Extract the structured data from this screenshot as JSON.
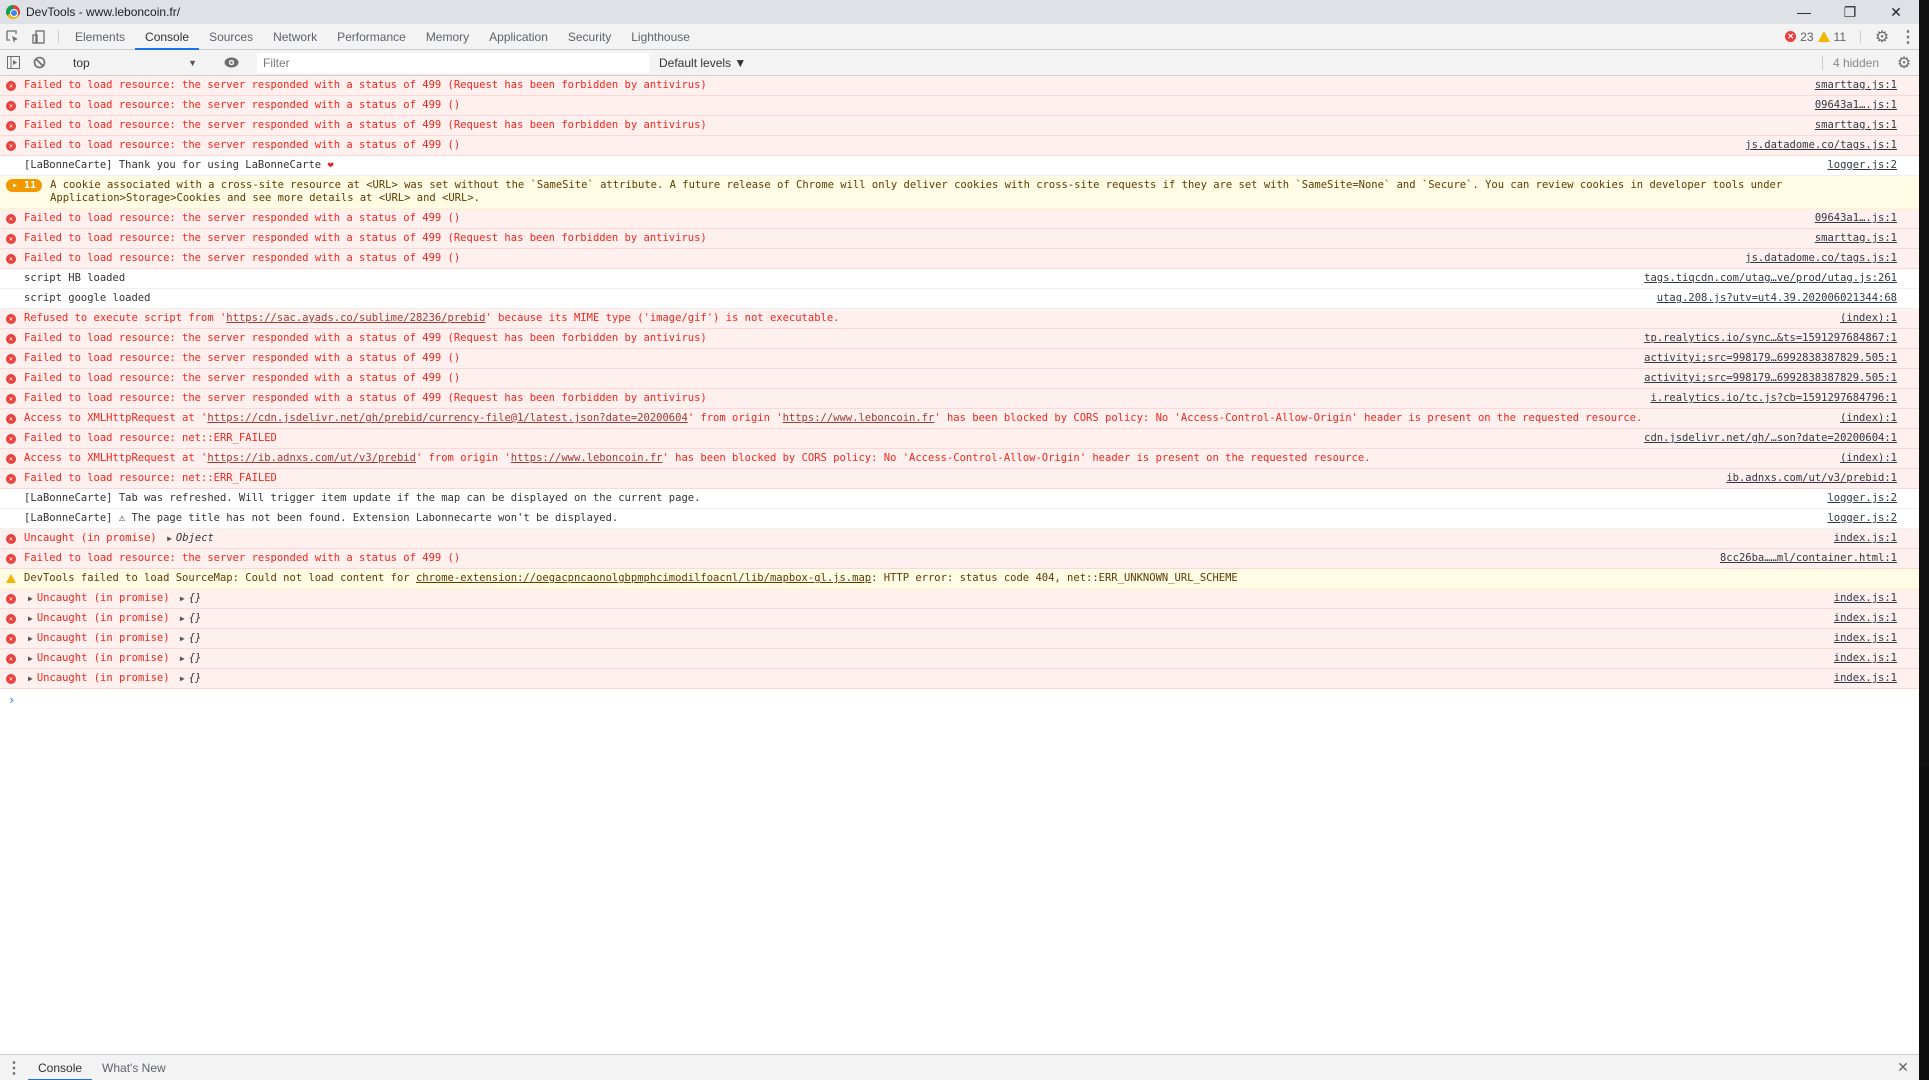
{
  "window": {
    "title": "DevTools - www.leboncoin.fr/",
    "controls": {
      "minimize": "—",
      "restore": "❐",
      "close": "✕"
    }
  },
  "tabs": [
    {
      "label": "Elements",
      "active": false
    },
    {
      "label": "Console",
      "active": true
    },
    {
      "label": "Sources",
      "active": false
    },
    {
      "label": "Network",
      "active": false
    },
    {
      "label": "Performance",
      "active": false
    },
    {
      "label": "Memory",
      "active": false
    },
    {
      "label": "Application",
      "active": false
    },
    {
      "label": "Security",
      "active": false
    },
    {
      "label": "Lighthouse",
      "active": false
    }
  ],
  "counts": {
    "errors": "23",
    "warnings": "11"
  },
  "console_toolbar": {
    "context": "top",
    "filter_placeholder": "Filter",
    "filter_value": "",
    "levels": "Default levels ▼",
    "hidden": "4 hidden"
  },
  "messages": [
    {
      "level": "error",
      "text": "Failed to load resource: the server responded with a status of 499 (Request has been forbidden by antivirus)",
      "source": "smarttag.js:1"
    },
    {
      "level": "error",
      "text": "Failed to load resource: the server responded with a status of 499 ()",
      "source": "09643a1….js:1"
    },
    {
      "level": "error",
      "text": "Failed to load resource: the server responded with a status of 499 (Request has been forbidden by antivirus)",
      "source": "smarttag.js:1"
    },
    {
      "level": "error",
      "text": "Failed to load resource: the server responded with a status of 499 ()",
      "source": "js.datadome.co/tags.js:1"
    },
    {
      "level": "info",
      "text": "[LaBonneCarte] Thank you for using LaBonneCarte",
      "suffix": "❤",
      "source": "logger.js:2"
    },
    {
      "level": "warning",
      "repeat": "11",
      "text": "A cookie associated with a cross-site resource at <URL> was set without the `SameSite` attribute. A future release of Chrome will only deliver cookies with cross-site requests if they are set with `SameSite=None` and `Secure`. You can review cookies in developer tools under Application>Storage>Cookies and see more details at <URL> and <URL>.",
      "source": ""
    },
    {
      "level": "error",
      "text": "Failed to load resource: the server responded with a status of 499 ()",
      "source": "09643a1….js:1"
    },
    {
      "level": "error",
      "text": "Failed to load resource: the server responded with a status of 499 (Request has been forbidden by antivirus)",
      "source": "smarttag.js:1"
    },
    {
      "level": "error",
      "text": "Failed to load resource: the server responded with a status of 499 ()",
      "source": "js.datadome.co/tags.js:1"
    },
    {
      "level": "info",
      "text": "script HB loaded",
      "source": "tags.tiqcdn.com/utag…ve/prod/utag.js:261"
    },
    {
      "level": "info",
      "text": "script google loaded",
      "source": "utag.208.js?utv=ut4.39.202006021344:68"
    },
    {
      "level": "error",
      "parts": [
        "Refused to execute script from '",
        {
          "link": "https://sac.ayads.co/sublime/28236/prebid"
        },
        "' because its MIME type ('image/gif') is not executable."
      ],
      "source": "(index):1"
    },
    {
      "level": "error",
      "text": "Failed to load resource: the server responded with a status of 499 (Request has been forbidden by antivirus)",
      "source": "tp.realytics.io/sync…&ts=1591297684867:1"
    },
    {
      "level": "error",
      "text": "Failed to load resource: the server responded with a status of 499 ()",
      "source": "activityi;src=998179…6992838387829.505:1"
    },
    {
      "level": "error",
      "text": "Failed to load resource: the server responded with a status of 499 ()",
      "source": "activityi;src=998179…6992838387829.505:1"
    },
    {
      "level": "error",
      "text": "Failed to load resource: the server responded with a status of 499 (Request has been forbidden by antivirus)",
      "source": "i.realytics.io/tc.js?cb=1591297684796:1"
    },
    {
      "level": "error",
      "parts": [
        "Access to XMLHttpRequest at '",
        {
          "link": "https://cdn.jsdelivr.net/gh/prebid/currency-file@1/latest.json?date=20200604"
        },
        "' from origin '",
        {
          "link": "https://www.leboncoin.fr"
        },
        "' has been blocked by CORS policy: No 'Access-Control-Allow-Origin' header is present on the requested resource."
      ],
      "source": "(index):1"
    },
    {
      "level": "error",
      "text": "Failed to load resource: net::ERR_FAILED",
      "source": "cdn.jsdelivr.net/gh/…son?date=20200604:1"
    },
    {
      "level": "error",
      "parts": [
        "Access to XMLHttpRequest at '",
        {
          "link": "https://ib.adnxs.com/ut/v3/prebid"
        },
        "' from origin '",
        {
          "link": "https://www.leboncoin.fr"
        },
        "' has been blocked by CORS policy: No 'Access-Control-Allow-Origin' header is present on the requested resource."
      ],
      "source": "(index):1"
    },
    {
      "level": "error",
      "text": "Failed to load resource: net::ERR_FAILED",
      "source": "ib.adnxs.com/ut/v3/prebid:1"
    },
    {
      "level": "info",
      "text": "[LaBonneCarte] Tab was refreshed. Will trigger item update if the map can be displayed on the current page.",
      "source": "logger.js:2"
    },
    {
      "level": "info",
      "text": "[LaBonneCarte] ⚠ The page title has not been found. Extension Labonnecarte won't be displayed.",
      "source": "logger.js:2"
    },
    {
      "level": "error",
      "text": "Uncaught (in promise) ",
      "expand": "Object",
      "source": "index.js:1"
    },
    {
      "level": "error",
      "text": "Failed to load resource: the server responded with a status of 499 ()",
      "source": "8cc26ba……ml/container.html:1"
    },
    {
      "level": "warning",
      "parts": [
        "DevTools failed to load SourceMap: Could not load content for ",
        {
          "link": "chrome-extension://oegacpncaonolgbpmphcimodilfoacnl/lib/mapbox-gl.js.map"
        },
        ": HTTP error: status code 404, net::ERR_UNKNOWN_URL_SCHEME"
      ],
      "source": ""
    },
    {
      "level": "error",
      "collapsible": true,
      "text": "Uncaught (in promise) ",
      "expand": "{}",
      "source": "index.js:1"
    },
    {
      "level": "error",
      "collapsible": true,
      "text": "Uncaught (in promise) ",
      "expand": "{}",
      "source": "index.js:1"
    },
    {
      "level": "error",
      "collapsible": true,
      "text": "Uncaught (in promise) ",
      "expand": "{}",
      "source": "index.js:1"
    },
    {
      "level": "error",
      "collapsible": true,
      "text": "Uncaught (in promise) ",
      "expand": "{}",
      "source": "index.js:1"
    },
    {
      "level": "error",
      "collapsible": true,
      "text": "Uncaught (in promise) ",
      "expand": "{}",
      "source": "index.js:1"
    }
  ],
  "prompt": "›",
  "drawer": {
    "tabs": [
      {
        "label": "Console",
        "active": true
      },
      {
        "label": "What's New",
        "active": false
      }
    ],
    "close": "✕"
  }
}
